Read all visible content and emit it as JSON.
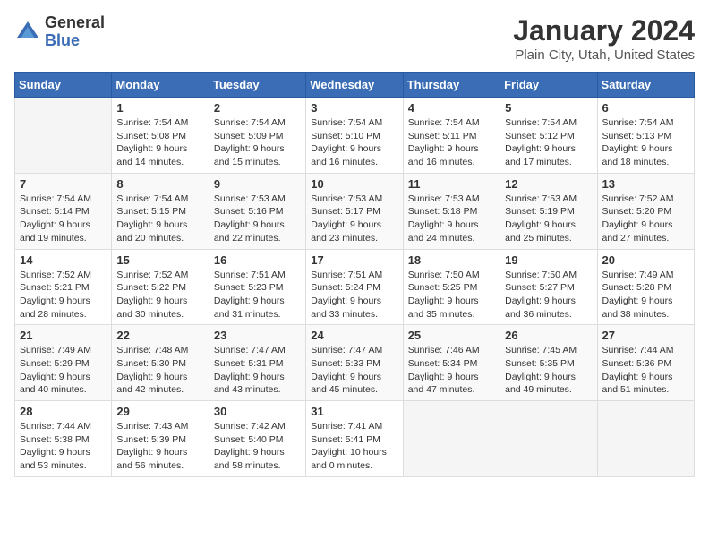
{
  "header": {
    "logo_general": "General",
    "logo_blue": "Blue",
    "title": "January 2024",
    "location": "Plain City, Utah, United States"
  },
  "calendar": {
    "days_of_week": [
      "Sunday",
      "Monday",
      "Tuesday",
      "Wednesday",
      "Thursday",
      "Friday",
      "Saturday"
    ],
    "weeks": [
      [
        {
          "day": "",
          "sunrise": "",
          "sunset": "",
          "daylight": "",
          "empty": true
        },
        {
          "day": "1",
          "sunrise": "Sunrise: 7:54 AM",
          "sunset": "Sunset: 5:08 PM",
          "daylight": "Daylight: 9 hours and 14 minutes."
        },
        {
          "day": "2",
          "sunrise": "Sunrise: 7:54 AM",
          "sunset": "Sunset: 5:09 PM",
          "daylight": "Daylight: 9 hours and 15 minutes."
        },
        {
          "day": "3",
          "sunrise": "Sunrise: 7:54 AM",
          "sunset": "Sunset: 5:10 PM",
          "daylight": "Daylight: 9 hours and 16 minutes."
        },
        {
          "day": "4",
          "sunrise": "Sunrise: 7:54 AM",
          "sunset": "Sunset: 5:11 PM",
          "daylight": "Daylight: 9 hours and 16 minutes."
        },
        {
          "day": "5",
          "sunrise": "Sunrise: 7:54 AM",
          "sunset": "Sunset: 5:12 PM",
          "daylight": "Daylight: 9 hours and 17 minutes."
        },
        {
          "day": "6",
          "sunrise": "Sunrise: 7:54 AM",
          "sunset": "Sunset: 5:13 PM",
          "daylight": "Daylight: 9 hours and 18 minutes."
        }
      ],
      [
        {
          "day": "7",
          "sunrise": "Sunrise: 7:54 AM",
          "sunset": "Sunset: 5:14 PM",
          "daylight": "Daylight: 9 hours and 19 minutes."
        },
        {
          "day": "8",
          "sunrise": "Sunrise: 7:54 AM",
          "sunset": "Sunset: 5:15 PM",
          "daylight": "Daylight: 9 hours and 20 minutes."
        },
        {
          "day": "9",
          "sunrise": "Sunrise: 7:53 AM",
          "sunset": "Sunset: 5:16 PM",
          "daylight": "Daylight: 9 hours and 22 minutes."
        },
        {
          "day": "10",
          "sunrise": "Sunrise: 7:53 AM",
          "sunset": "Sunset: 5:17 PM",
          "daylight": "Daylight: 9 hours and 23 minutes."
        },
        {
          "day": "11",
          "sunrise": "Sunrise: 7:53 AM",
          "sunset": "Sunset: 5:18 PM",
          "daylight": "Daylight: 9 hours and 24 minutes."
        },
        {
          "day": "12",
          "sunrise": "Sunrise: 7:53 AM",
          "sunset": "Sunset: 5:19 PM",
          "daylight": "Daylight: 9 hours and 25 minutes."
        },
        {
          "day": "13",
          "sunrise": "Sunrise: 7:52 AM",
          "sunset": "Sunset: 5:20 PM",
          "daylight": "Daylight: 9 hours and 27 minutes."
        }
      ],
      [
        {
          "day": "14",
          "sunrise": "Sunrise: 7:52 AM",
          "sunset": "Sunset: 5:21 PM",
          "daylight": "Daylight: 9 hours and 28 minutes."
        },
        {
          "day": "15",
          "sunrise": "Sunrise: 7:52 AM",
          "sunset": "Sunset: 5:22 PM",
          "daylight": "Daylight: 9 hours and 30 minutes."
        },
        {
          "day": "16",
          "sunrise": "Sunrise: 7:51 AM",
          "sunset": "Sunset: 5:23 PM",
          "daylight": "Daylight: 9 hours and 31 minutes."
        },
        {
          "day": "17",
          "sunrise": "Sunrise: 7:51 AM",
          "sunset": "Sunset: 5:24 PM",
          "daylight": "Daylight: 9 hours and 33 minutes."
        },
        {
          "day": "18",
          "sunrise": "Sunrise: 7:50 AM",
          "sunset": "Sunset: 5:25 PM",
          "daylight": "Daylight: 9 hours and 35 minutes."
        },
        {
          "day": "19",
          "sunrise": "Sunrise: 7:50 AM",
          "sunset": "Sunset: 5:27 PM",
          "daylight": "Daylight: 9 hours and 36 minutes."
        },
        {
          "day": "20",
          "sunrise": "Sunrise: 7:49 AM",
          "sunset": "Sunset: 5:28 PM",
          "daylight": "Daylight: 9 hours and 38 minutes."
        }
      ],
      [
        {
          "day": "21",
          "sunrise": "Sunrise: 7:49 AM",
          "sunset": "Sunset: 5:29 PM",
          "daylight": "Daylight: 9 hours and 40 minutes."
        },
        {
          "day": "22",
          "sunrise": "Sunrise: 7:48 AM",
          "sunset": "Sunset: 5:30 PM",
          "daylight": "Daylight: 9 hours and 42 minutes."
        },
        {
          "day": "23",
          "sunrise": "Sunrise: 7:47 AM",
          "sunset": "Sunset: 5:31 PM",
          "daylight": "Daylight: 9 hours and 43 minutes."
        },
        {
          "day": "24",
          "sunrise": "Sunrise: 7:47 AM",
          "sunset": "Sunset: 5:33 PM",
          "daylight": "Daylight: 9 hours and 45 minutes."
        },
        {
          "day": "25",
          "sunrise": "Sunrise: 7:46 AM",
          "sunset": "Sunset: 5:34 PM",
          "daylight": "Daylight: 9 hours and 47 minutes."
        },
        {
          "day": "26",
          "sunrise": "Sunrise: 7:45 AM",
          "sunset": "Sunset: 5:35 PM",
          "daylight": "Daylight: 9 hours and 49 minutes."
        },
        {
          "day": "27",
          "sunrise": "Sunrise: 7:44 AM",
          "sunset": "Sunset: 5:36 PM",
          "daylight": "Daylight: 9 hours and 51 minutes."
        }
      ],
      [
        {
          "day": "28",
          "sunrise": "Sunrise: 7:44 AM",
          "sunset": "Sunset: 5:38 PM",
          "daylight": "Daylight: 9 hours and 53 minutes."
        },
        {
          "day": "29",
          "sunrise": "Sunrise: 7:43 AM",
          "sunset": "Sunset: 5:39 PM",
          "daylight": "Daylight: 9 hours and 56 minutes."
        },
        {
          "day": "30",
          "sunrise": "Sunrise: 7:42 AM",
          "sunset": "Sunset: 5:40 PM",
          "daylight": "Daylight: 9 hours and 58 minutes."
        },
        {
          "day": "31",
          "sunrise": "Sunrise: 7:41 AM",
          "sunset": "Sunset: 5:41 PM",
          "daylight": "Daylight: 10 hours and 0 minutes."
        },
        {
          "day": "",
          "sunrise": "",
          "sunset": "",
          "daylight": "",
          "empty": true
        },
        {
          "day": "",
          "sunrise": "",
          "sunset": "",
          "daylight": "",
          "empty": true
        },
        {
          "day": "",
          "sunrise": "",
          "sunset": "",
          "daylight": "",
          "empty": true
        }
      ]
    ]
  }
}
